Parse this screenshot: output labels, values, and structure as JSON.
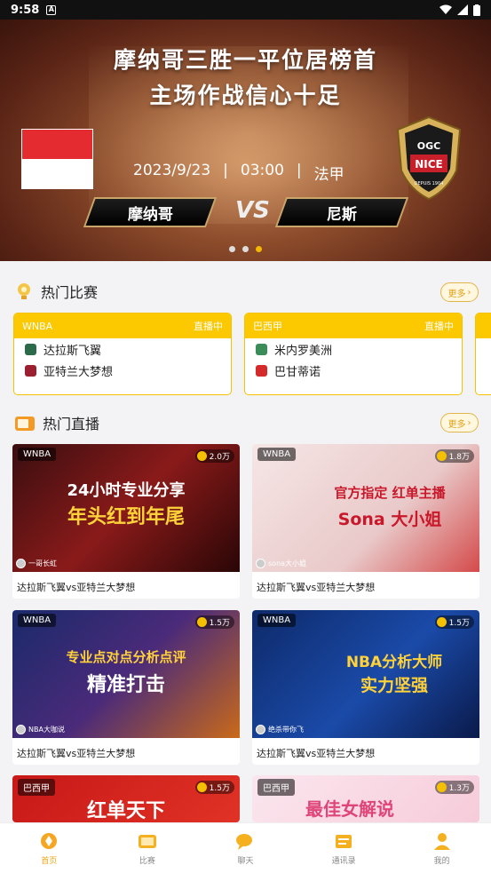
{
  "status": {
    "time": "9:58",
    "a": "A"
  },
  "banner": {
    "line1": "摩纳哥三胜一平位居榜首",
    "line2": "主场作战信心十足",
    "date": "2023/9/23",
    "time": "03:00",
    "sep": "|",
    "league": "法甲",
    "home": "摩纳哥",
    "away": "尼斯",
    "vs": "VS",
    "logo_top": "OGC",
    "logo_main": "NICE",
    "logo_year": "DEPUIS 1904"
  },
  "hot_matches": {
    "title": "热门比赛",
    "more": "更多",
    "cards": [
      {
        "league": "WNBA",
        "status": "直播中",
        "home": "达拉斯飞翼",
        "away": "亚特兰大梦想"
      },
      {
        "league": "巴西甲",
        "status": "直播中",
        "home": "米内罗美洲",
        "away": "巴甘蒂诺"
      }
    ]
  },
  "hot_live": {
    "title": "热门直播",
    "more": "更多",
    "cards": [
      {
        "tag": "WNBA",
        "viewers": "2.0万",
        "host": "一哥长虹",
        "overlay1": "24小时专业分享",
        "overlay2": "年头红到年尾",
        "caption": "达拉斯飞翼vs亚特兰大梦想"
      },
      {
        "tag": "WNBA",
        "viewers": "1.8万",
        "host": "sona大小姐",
        "overlay1": "官方指定 红单主播",
        "overlay2": "Sona 大小姐",
        "caption": "达拉斯飞翼vs亚特兰大梦想"
      },
      {
        "tag": "WNBA",
        "viewers": "1.5万",
        "host": "NBA大咖说",
        "overlay1": "专业点对点分析点评",
        "overlay2": "精准打击",
        "caption": "达拉斯飞翼vs亚特兰大梦想"
      },
      {
        "tag": "WNBA",
        "viewers": "1.5万",
        "host": "绝杀带你飞",
        "overlay1": "NBA分析大师",
        "overlay2": "实力坚强",
        "caption": "达拉斯飞翼vs亚特兰大梦想"
      },
      {
        "tag": "巴西甲",
        "viewers": "1.5万",
        "overlay1": "红单天下"
      },
      {
        "tag": "巴西甲",
        "viewers": "1.3万",
        "overlay1": "最佳女解说"
      }
    ]
  },
  "nav": {
    "items": [
      {
        "label": "首页",
        "icon": "home-icon"
      },
      {
        "label": "比赛",
        "icon": "match-icon"
      },
      {
        "label": "聊天",
        "icon": "chat-icon"
      },
      {
        "label": "通讯录",
        "icon": "contacts-icon"
      },
      {
        "label": "我的",
        "icon": "profile-icon"
      }
    ]
  },
  "colors": {
    "accent": "#fcc800",
    "active": "#e9a413"
  }
}
